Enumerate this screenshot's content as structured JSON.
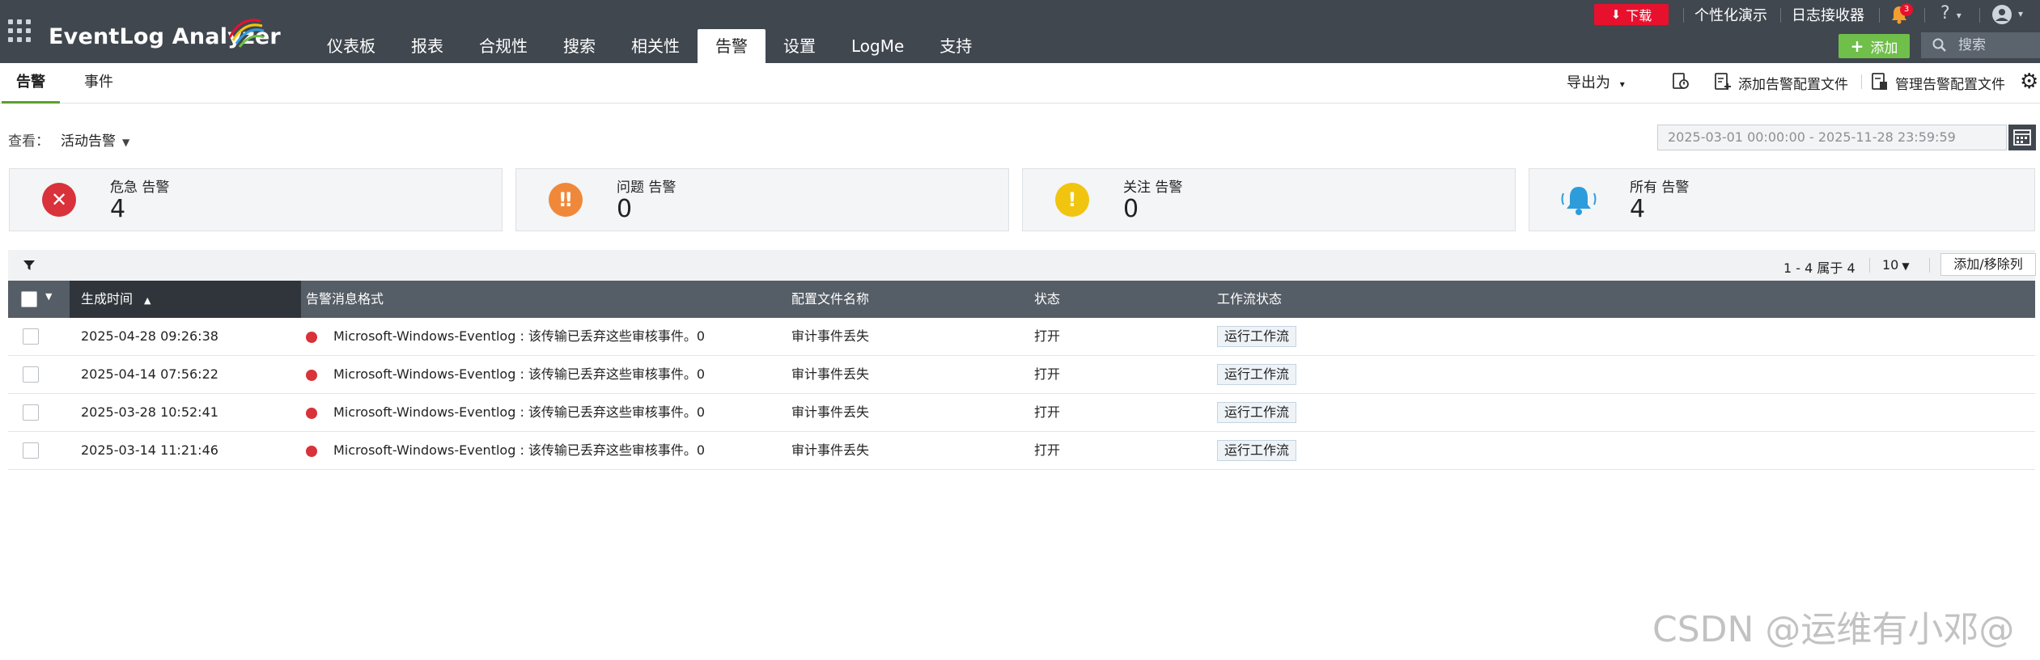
{
  "app": {
    "title": "EventLog Analyzer"
  },
  "nav": {
    "tabs": [
      "仪表板",
      "报表",
      "合规性",
      "搜索",
      "相关性",
      "告警",
      "设置",
      "LogMe",
      "支持"
    ],
    "active_index": 5
  },
  "topbar": {
    "download": "下载",
    "personalize_demo": "个性化演示",
    "log_receiver": "日志接收器",
    "notification_count": "3",
    "help": "?",
    "add_button": "添加",
    "search_placeholder": "搜索"
  },
  "subnav": {
    "tabs": [
      "告警",
      "事件"
    ],
    "export": "导出为",
    "add_profile": "添加告警配置文件",
    "manage_profiles": "管理告警配置文件"
  },
  "view": {
    "label": "查看：",
    "selected": "活动告警"
  },
  "date_range": "2025-03-01 00:00:00 - 2025-11-28 23:59:59",
  "summary": [
    {
      "title": "危急 告警",
      "count": "4",
      "color": "#d9323a",
      "icon": "close-icon"
    },
    {
      "title": "问题 告警",
      "count": "0",
      "color": "#f0883a",
      "icon": "double-exclamation-icon"
    },
    {
      "title": "关注 告警",
      "count": "0",
      "color": "#f1c40f",
      "icon": "exclamation-icon"
    },
    {
      "title": "所有 告警",
      "count": "4",
      "color": "#2d9cdb",
      "icon": "bell-icon"
    }
  ],
  "table": {
    "pagination": "1 - 4 属于 4",
    "page_size": "10",
    "columns_button": "添加/移除列",
    "columns": [
      "生成时间",
      "告警消息格式",
      "配置文件名称",
      "状态",
      "工作流状态"
    ],
    "rows": [
      {
        "time": "2025-04-28 09:26:38",
        "message": "Microsoft-Windows-Eventlog : 该传输已丢弃这些审核事件。0",
        "profile": "审计事件丢失",
        "status": "打开",
        "workflow": "运行工作流"
      },
      {
        "time": "2025-04-14 07:56:22",
        "message": "Microsoft-Windows-Eventlog : 该传输已丢弃这些审核事件。0",
        "profile": "审计事件丢失",
        "status": "打开",
        "workflow": "运行工作流"
      },
      {
        "time": "2025-03-28 10:52:41",
        "message": "Microsoft-Windows-Eventlog : 该传输已丢弃这些审核事件。0",
        "profile": "审计事件丢失",
        "status": "打开",
        "workflow": "运行工作流"
      },
      {
        "time": "2025-03-14 11:21:46",
        "message": "Microsoft-Windows-Eventlog : 该传输已丢弃这些审核事件。0",
        "profile": "审计事件丢失",
        "status": "打开",
        "workflow": "运行工作流"
      }
    ]
  },
  "watermark": "CSDN @运维有小邓@"
}
